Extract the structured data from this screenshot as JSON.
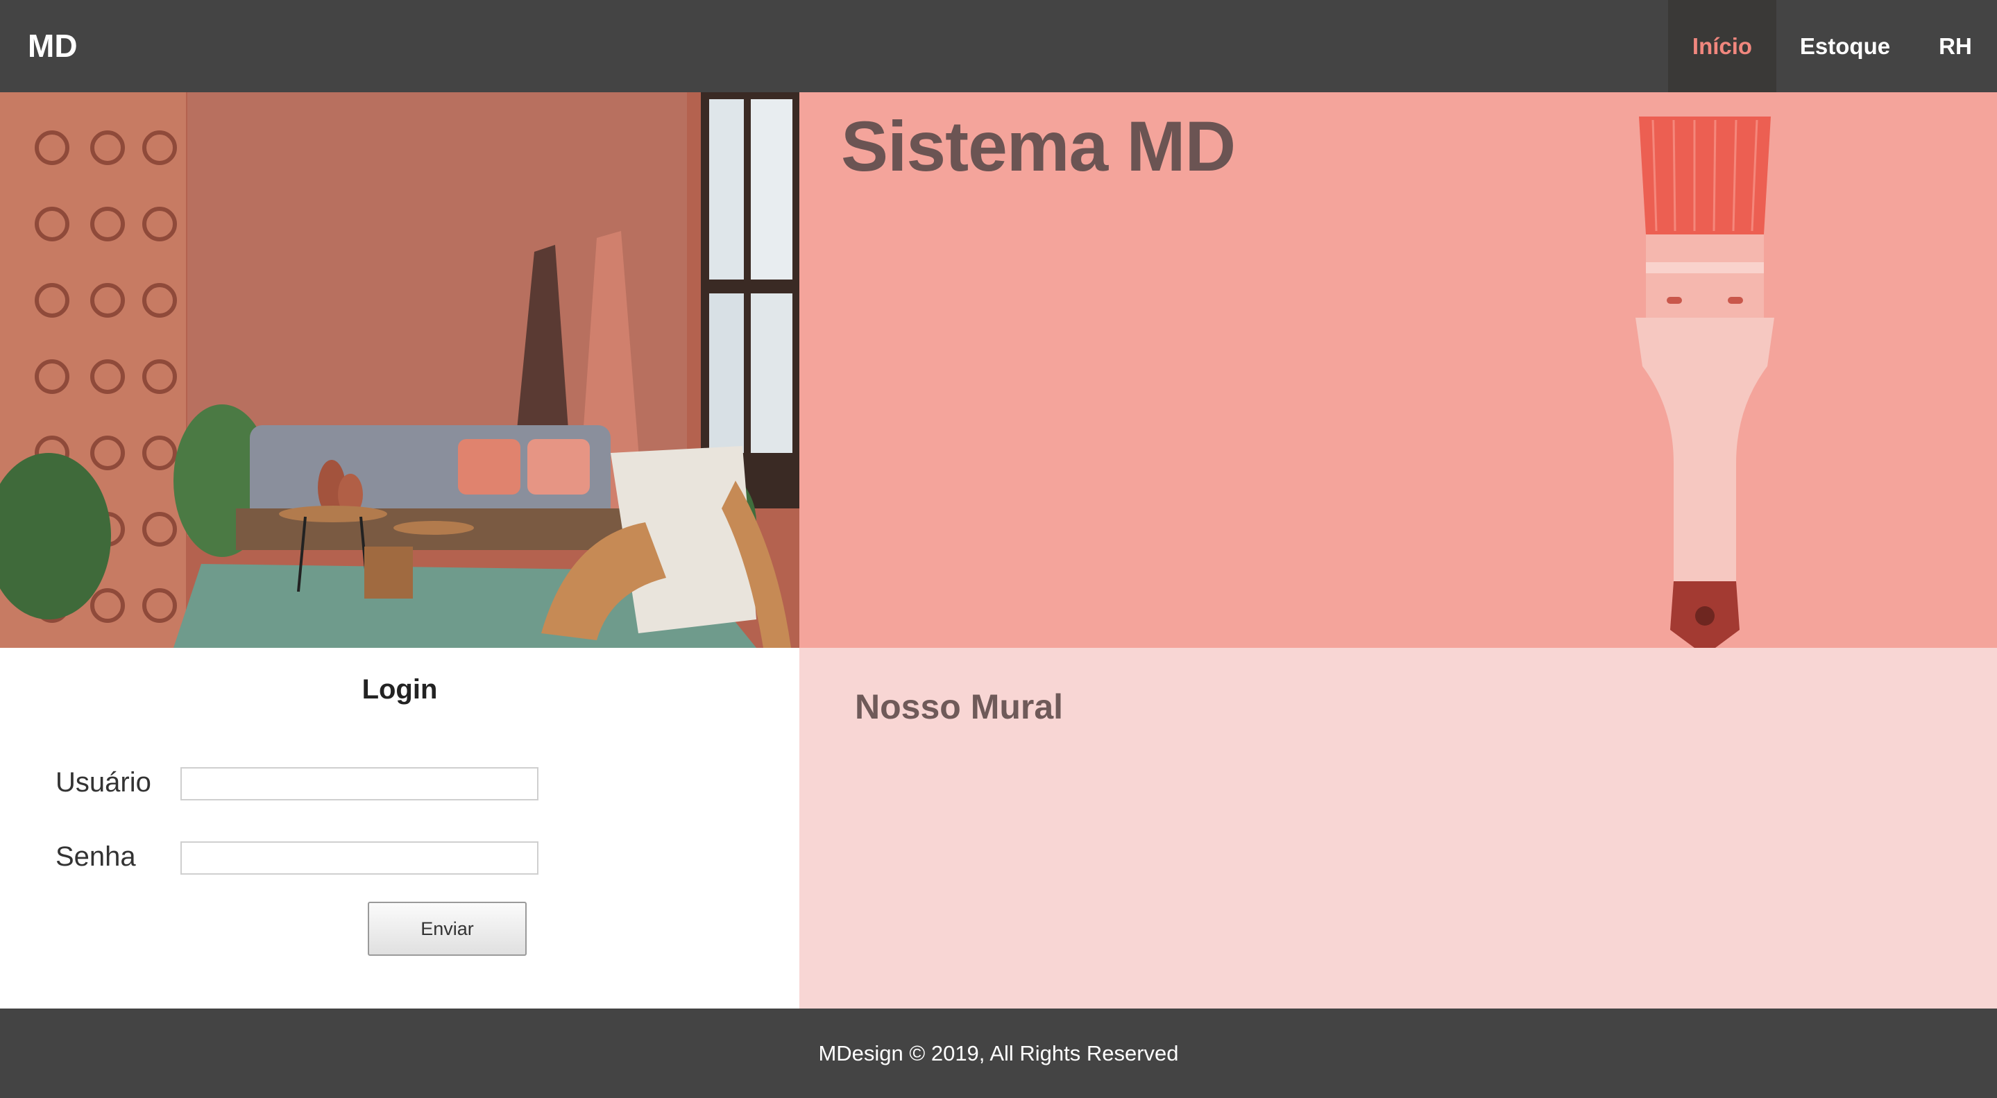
{
  "nav": {
    "brand": "MD",
    "items": [
      {
        "label": "Início",
        "active": true
      },
      {
        "label": "Estoque",
        "active": false
      },
      {
        "label": "RH",
        "active": false
      }
    ]
  },
  "hero": {
    "title": "Sistema MD"
  },
  "login": {
    "title": "Login",
    "username_label": "Usuário",
    "username_value": "",
    "password_label": "Senha",
    "password_value": "",
    "submit_label": "Enviar"
  },
  "mural": {
    "title": "Nosso Mural"
  },
  "footer": {
    "text": "MDesign © 2019, All Rights Reserved"
  },
  "colors": {
    "nav_bg": "#444444",
    "nav_active_text": "#f0877e",
    "hero_bg": "#f4a49b",
    "mural_bg": "#f8d6d4",
    "heading_text": "#6b5453"
  }
}
